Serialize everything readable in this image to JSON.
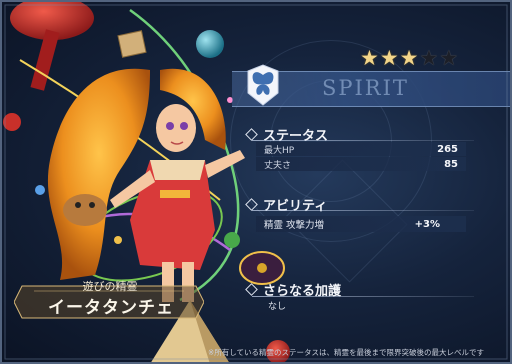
{
  "spirit": {
    "rarity": {
      "max": 5,
      "filled": 3
    },
    "attribute": {
      "label": "SPIRIT",
      "icon": "butterfly-icon"
    },
    "title": "遊びの精霊",
    "name": "イータタンチェ"
  },
  "status": {
    "heading": "ステータス",
    "rows": [
      {
        "label": "最大HP",
        "value": "265"
      },
      {
        "label": "丈夫さ",
        "value": "85"
      }
    ]
  },
  "ability": {
    "heading": "アビリティ",
    "rows": [
      {
        "label": "精霊 攻撃力増",
        "value": "+3%"
      }
    ]
  },
  "extra": {
    "heading": "さらなる加護",
    "value": "なし"
  },
  "footnote": "※所有している精霊のステータスは、精霊を最後まで限界突破後の最大レベルです",
  "colors": {
    "background": "#0c1526",
    "star_on": "#f2d58a",
    "banner": "#32507f",
    "accent_orange": "#e88a2a"
  }
}
